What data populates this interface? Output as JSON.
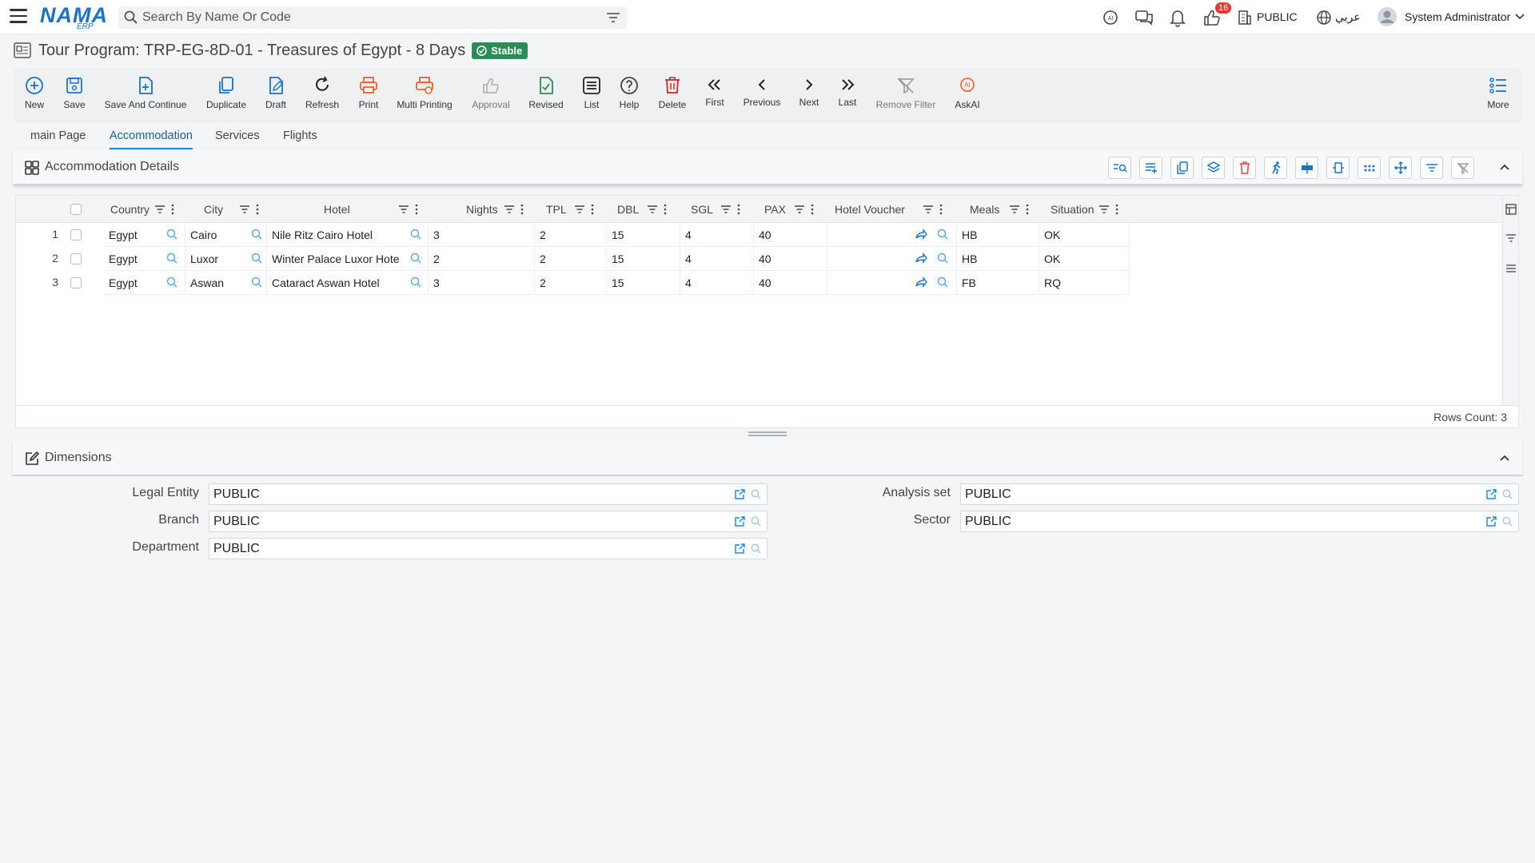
{
  "header": {
    "logo_text": "NAMA",
    "logo_sub": "ERP",
    "search_placeholder": "Search By Name Or Code",
    "notification_count": "16",
    "company": "PUBLIC",
    "language": "عربي",
    "user": "System Administrator"
  },
  "page": {
    "title": "Tour Program: TRP-EG-8D-01 - Treasures of Egypt - 8 Days",
    "status": "Stable"
  },
  "toolbar": {
    "new": "New",
    "save": "Save",
    "save_continue": "Save And Continue",
    "duplicate": "Duplicate",
    "draft": "Draft",
    "refresh": "Refresh",
    "print": "Print",
    "multi_printing": "Multi Printing",
    "approval": "Approval",
    "revised": "Revised",
    "list": "List",
    "help": "Help",
    "delete": "Delete",
    "first": "First",
    "previous": "Previous",
    "next": "Next",
    "last": "Last",
    "remove_filter": "Remove Filter",
    "askai": "AskAI",
    "more": "More"
  },
  "tabs": [
    "main Page",
    "Accommodation",
    "Services",
    "Flights"
  ],
  "accommodation": {
    "title": "Accommodation Details",
    "columns": [
      "Country",
      "City",
      "Hotel",
      "Nights",
      "TPL",
      "DBL",
      "SGL",
      "PAX",
      "Hotel Voucher",
      "Meals",
      "Situation"
    ],
    "rows": [
      {
        "num": "1",
        "country": "Egypt",
        "city": "Cairo",
        "hotel": "Nile Ritz Cairo Hotel",
        "nights": "3",
        "tpl": "2",
        "dbl": "15",
        "sgl": "4",
        "pax": "40",
        "meals": "HB",
        "situation": "OK"
      },
      {
        "num": "2",
        "country": "Egypt",
        "city": "Luxor",
        "hotel": "Winter Palace Luxor Hote",
        "nights": "2",
        "tpl": "2",
        "dbl": "15",
        "sgl": "4",
        "pax": "40",
        "meals": "HB",
        "situation": "OK"
      },
      {
        "num": "3",
        "country": "Egypt",
        "city": "Aswan",
        "hotel": "Cataract Aswan Hotel",
        "nights": "3",
        "tpl": "2",
        "dbl": "15",
        "sgl": "4",
        "pax": "40",
        "meals": "FB",
        "situation": "RQ"
      }
    ],
    "rows_count": "Rows Count: 3"
  },
  "dimensions": {
    "title": "Dimensions",
    "legal_entity_label": "Legal Entity",
    "legal_entity": "PUBLIC",
    "branch_label": "Branch",
    "branch": "PUBLIC",
    "department_label": "Department",
    "department": "PUBLIC",
    "analysis_set_label": "Analysis set",
    "analysis_set": "PUBLIC",
    "sector_label": "Sector",
    "sector": "PUBLIC"
  },
  "colors": {
    "accent": "#1a73c8",
    "stable": "#2e8b57",
    "badge": "#e53935",
    "print": "#e8622c"
  }
}
